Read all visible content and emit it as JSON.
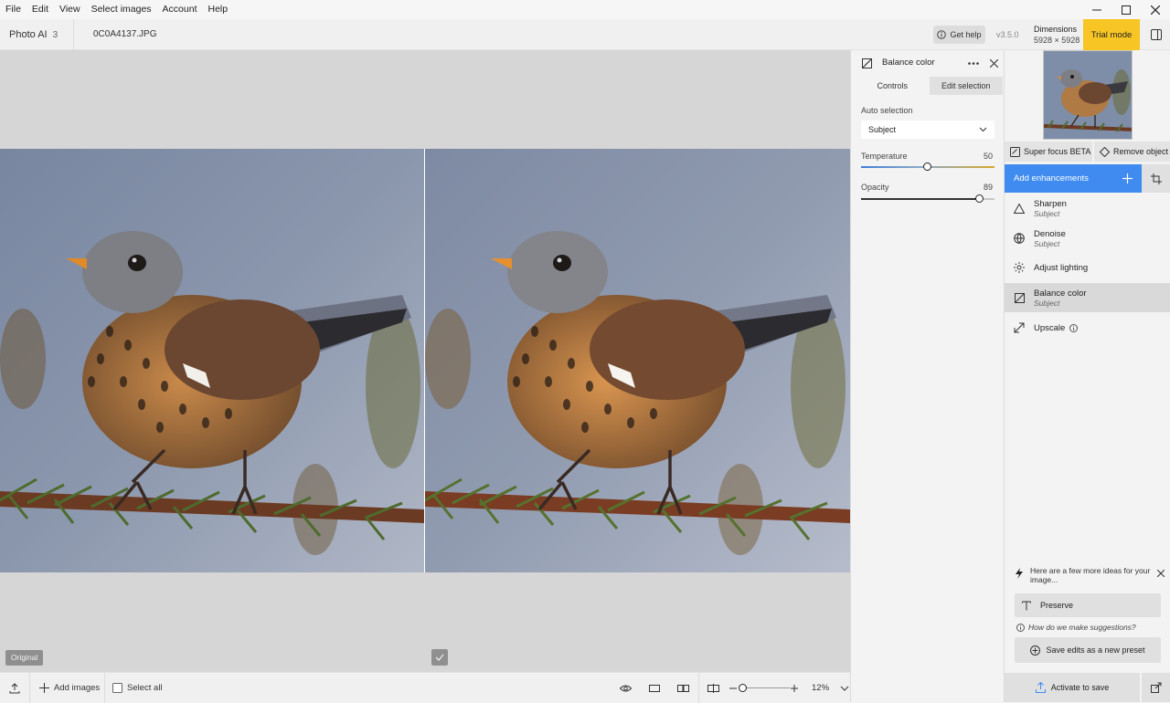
{
  "menu": [
    "File",
    "Edit",
    "View",
    "Select images",
    "Account",
    "Help"
  ],
  "app": {
    "name": "Photo AI",
    "count": "3",
    "filename": "0C0A4137.JPG"
  },
  "header": {
    "get_help": "Get help",
    "version": "v3.5.0",
    "dimensions_label": "Dimensions",
    "dimensions_value": "5928 × 5928",
    "trial": "Trial mode"
  },
  "canvas": {
    "original_tag": "Original"
  },
  "bottom": {
    "add_images": "Add images",
    "select_all": "Select all",
    "zoom": "12%",
    "zoom_level": 0.12
  },
  "controls": {
    "title": "Balance color",
    "tabs": [
      {
        "label": "Controls",
        "active": true
      },
      {
        "label": "Edit selection",
        "active": false
      }
    ],
    "auto_selection_label": "Auto selection",
    "auto_selection_value": "Subject",
    "temperature_label": "Temperature",
    "temperature_value": "50",
    "temperature_fraction": 0.5,
    "opacity_label": "Opacity",
    "opacity_value": "89",
    "opacity_fraction": 0.89
  },
  "sidebar": {
    "super_focus": "Super focus BETA",
    "remove_object": "Remove object",
    "add_enhancements": "Add enhancements",
    "enhancements": [
      {
        "label": "Sharpen",
        "sub": "Subject",
        "icon": "sharpen-icon"
      },
      {
        "label": "Denoise",
        "sub": "Subject",
        "icon": "denoise-icon"
      },
      {
        "label": "Adjust lighting",
        "sub": "",
        "icon": "lighting-icon"
      },
      {
        "label": "Balance color",
        "sub": "Subject",
        "icon": "balance-color-icon",
        "selected": true
      },
      {
        "label": "Upscale",
        "sub": "",
        "icon": "upscale-icon"
      }
    ],
    "ideas_text": "Here are a few more ideas for your image...",
    "preserve": "Preserve",
    "how_suggest": "How do we make suggestions?",
    "save_preset": "Save edits as a new preset",
    "activate": "Activate to save"
  },
  "colors": {
    "accent": "#3f8bf0",
    "trial": "#f7c524",
    "slider_temp": "#d4a72c"
  }
}
